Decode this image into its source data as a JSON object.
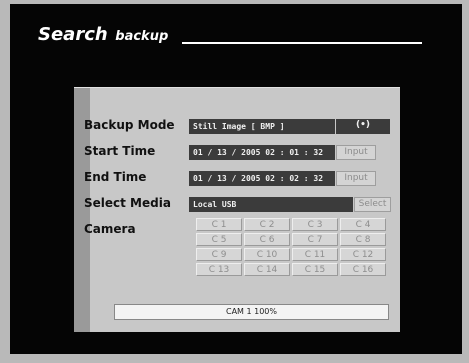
{
  "title_main": "Search",
  "title_sub": "backup",
  "form": {
    "backup_mode_label": "Backup Mode",
    "backup_mode_value": "Still Image [ BMP ]",
    "backup_mode_toggle": "(•)",
    "start_time_label": "Start Time",
    "start_time_value": "01 / 13 / 2005  02 : 01 : 32",
    "start_input_label": "Input",
    "end_time_label": "End Time",
    "end_time_value": "01 / 13 / 2005  02 : 02 : 32",
    "end_input_label": "Input",
    "select_media_label": "Select Media",
    "select_media_value": "Local USB",
    "select_button_label": "Select",
    "camera_label": "Camera"
  },
  "cameras": [
    "C  1",
    "C  2",
    "C  3",
    "C  4",
    "C  5",
    "C  6",
    "C  7",
    "C  8",
    "C  9",
    "C 10",
    "C 11",
    "C 12",
    "C 13",
    "C 14",
    "C 15",
    "C 16"
  ],
  "status_text": "CAM 1 100%"
}
